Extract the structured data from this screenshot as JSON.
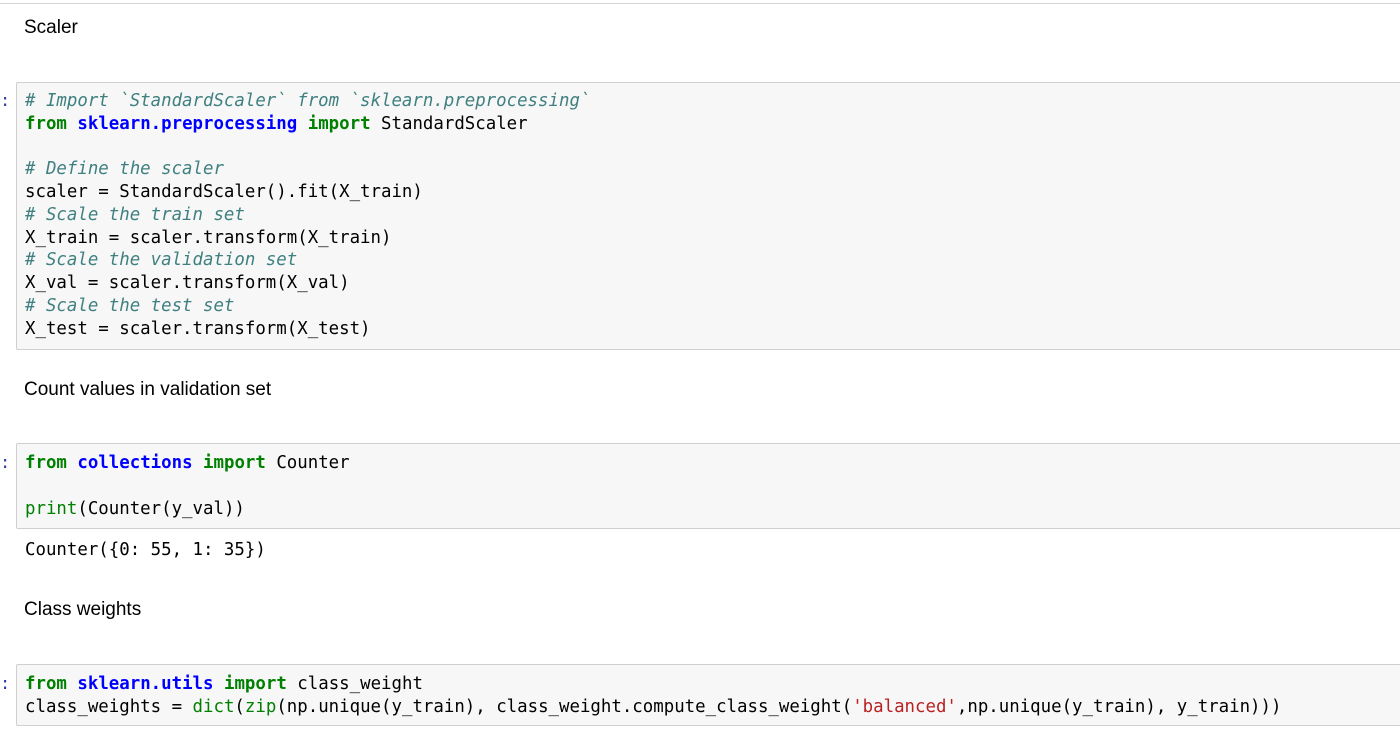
{
  "prompt_char": ":",
  "headings": {
    "scaler": "Scaler",
    "count_values": "Count values in validation set",
    "class_weights": "Class weights"
  },
  "cell1": {
    "comment_import": "# Import `StandardScaler` from `sklearn.preprocessing`",
    "kw_from": "from",
    "module": "sklearn.preprocessing",
    "kw_import": "import",
    "import_name": " StandardScaler",
    "comment_define": "# Define the scaler",
    "line_scaler": "scaler = StandardScaler().fit(X_train)",
    "comment_train": "# Scale the train set",
    "line_train": "X_train = scaler.transform(X_train)",
    "comment_val": "# Scale the validation set",
    "line_val": "X_val = scaler.transform(X_val)",
    "comment_test": "# Scale the test set",
    "line_test": "X_test = scaler.transform(X_test)"
  },
  "cell2": {
    "kw_from": "from",
    "module": "collections",
    "kw_import": "import",
    "import_name": " Counter",
    "builtin_print": "print",
    "print_args": "(Counter(y_val))",
    "output": "Counter({0: 55, 1: 35})"
  },
  "cell3": {
    "kw_from": "from",
    "module": "sklearn.utils",
    "kw_import": "import",
    "import_name": " class_weight",
    "line_prefix": "class_weights = ",
    "builtin_dict": "dict",
    "builtin_zip": "zip",
    "call_mid": "(np.unique(y_train), class_weight.compute_class_weight(",
    "string_balanced": "'balanced'",
    "call_end": ",np.unique(y_train), y_train)))"
  }
}
